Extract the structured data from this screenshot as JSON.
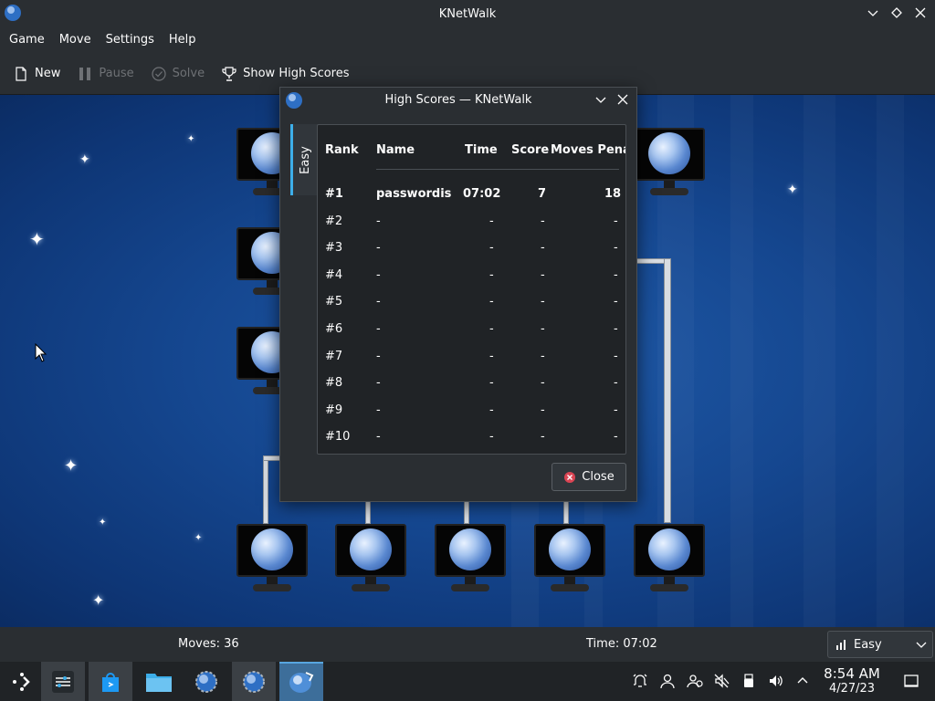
{
  "window": {
    "title": "KNetWalk"
  },
  "menu": [
    "Game",
    "Move",
    "Settings",
    "Help"
  ],
  "toolbar": {
    "new_label": "New",
    "pause_label": "Pause",
    "solve_label": "Solve",
    "highscores_label": "Show High Scores"
  },
  "status": {
    "moves": "Moves: 36",
    "time": "Time: 07:02",
    "difficulty": "Easy"
  },
  "dialog": {
    "title": "High Scores — KNetWalk",
    "tab": "Easy",
    "headers": [
      "Rank",
      "Name",
      "Time",
      "Score",
      "Moves Pena"
    ],
    "rows": [
      {
        "rank": "#1",
        "name": "passwordis",
        "time": "07:02",
        "score": "7",
        "moves": "18"
      },
      {
        "rank": "#2",
        "name": "-",
        "time": "-",
        "score": "-",
        "moves": "-"
      },
      {
        "rank": "#3",
        "name": "-",
        "time": "-",
        "score": "-",
        "moves": "-"
      },
      {
        "rank": "#4",
        "name": "-",
        "time": "-",
        "score": "-",
        "moves": "-"
      },
      {
        "rank": "#5",
        "name": "-",
        "time": "-",
        "score": "-",
        "moves": "-"
      },
      {
        "rank": "#6",
        "name": "-",
        "time": "-",
        "score": "-",
        "moves": "-"
      },
      {
        "rank": "#7",
        "name": "-",
        "time": "-",
        "score": "-",
        "moves": "-"
      },
      {
        "rank": "#8",
        "name": "-",
        "time": "-",
        "score": "-",
        "moves": "-"
      },
      {
        "rank": "#9",
        "name": "-",
        "time": "-",
        "score": "-",
        "moves": "-"
      },
      {
        "rank": "#10",
        "name": "-",
        "time": "-",
        "score": "-",
        "moves": "-"
      }
    ],
    "close_label": "Close"
  },
  "clock": {
    "time": "8:54 AM",
    "date": "4/27/23"
  },
  "colors": {
    "accent": "#3daee9",
    "background": "#154790",
    "panel": "#2a2e32"
  },
  "icons": {
    "taskbar": [
      "application-launcher-icon",
      "settings-icon",
      "discover-store-icon",
      "file-manager-icon",
      "knetwalk-icon",
      "knetwalk-icon",
      "knetwalk-active-icon"
    ],
    "tray": [
      "alarm-icon",
      "user-icon",
      "users-icon",
      "mute-icon",
      "usb-drive-icon",
      "volume-icon",
      "tray-expand-icon"
    ]
  }
}
